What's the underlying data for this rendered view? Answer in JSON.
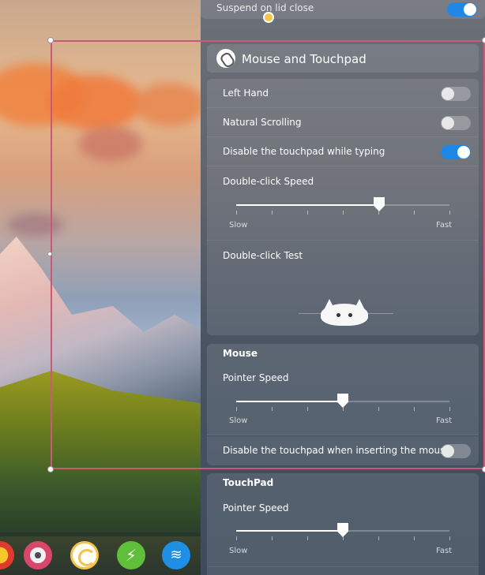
{
  "panel": {
    "top_partial_label": "Suspend on lid close",
    "title": "Mouse and Touchpad",
    "general": {
      "left_hand": {
        "label": "Left Hand",
        "on": false
      },
      "natural_scrolling": {
        "label": "Natural Scrolling",
        "on": false
      },
      "disable_touchpad_typing": {
        "label": "Disable the touchpad while typing",
        "on": true
      },
      "double_click_speed": {
        "label": "Double-click Speed",
        "slow": "Slow",
        "fast": "Fast",
        "value": 0.67
      },
      "double_click_test": {
        "label": "Double-click Test"
      }
    },
    "mouse": {
      "header": "Mouse",
      "pointer_speed": {
        "label": "Pointer Speed",
        "slow": "Slow",
        "fast": "Fast",
        "value": 0.5
      },
      "disable_touchpad_mouse": {
        "label": "Disable the touchpad when inserting the mouse",
        "on": false
      }
    },
    "touchpad": {
      "header": "TouchPad",
      "pointer_speed": {
        "label": "Pointer Speed",
        "slow": "Slow",
        "fast": "Fast",
        "value": 0.5
      }
    }
  },
  "dock": {
    "items": [
      "app-icon",
      "settings-icon",
      "app-icon",
      "power-icon",
      "wifi-icon"
    ]
  },
  "colors": {
    "accent": "#1f87e6",
    "selection": "#c85a78"
  }
}
